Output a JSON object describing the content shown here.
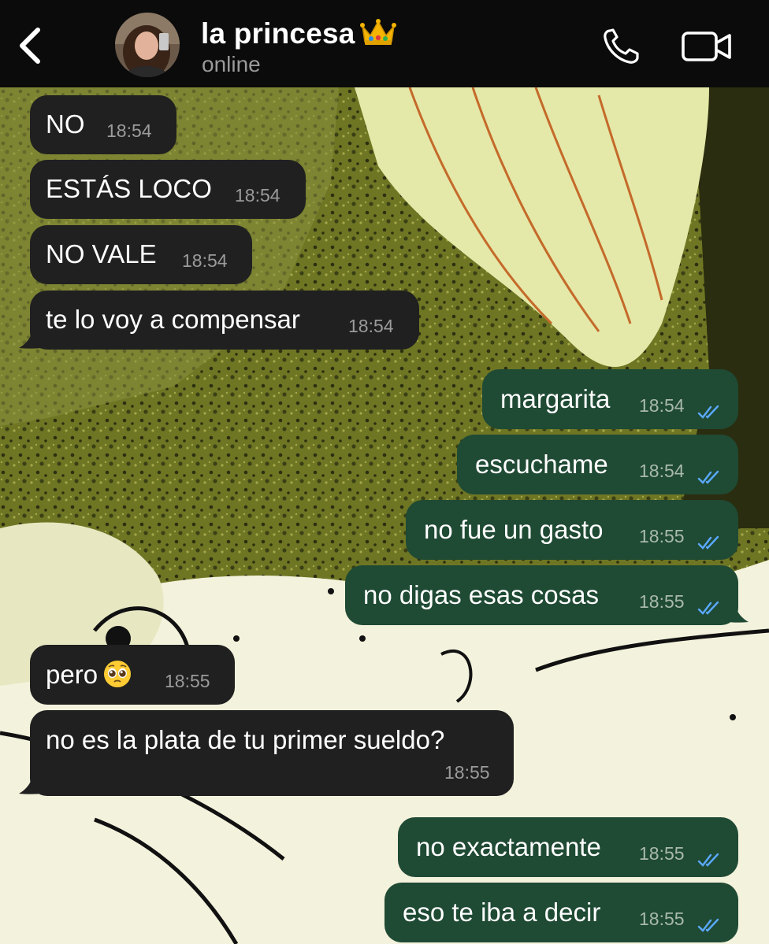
{
  "header": {
    "contact_name": "la princesa",
    "status": "online",
    "crown_emoji": "👑"
  },
  "colors": {
    "header_bg": "#0b0b0b",
    "incoming_bubble": "#202020",
    "outgoing_bubble": "#1f4a34",
    "read_ticks": "#5aa9ff"
  },
  "messages": [
    {
      "direction": "in",
      "text": "NO",
      "time": "18:54"
    },
    {
      "direction": "in",
      "text": "ESTÁS LOCO",
      "time": "18:54"
    },
    {
      "direction": "in",
      "text": "NO VALE",
      "time": "18:54"
    },
    {
      "direction": "in",
      "text": "te lo voy a compensar",
      "time": "18:54"
    },
    {
      "direction": "out",
      "text": "margarita",
      "time": "18:54"
    },
    {
      "direction": "out",
      "text": "escuchame",
      "time": "18:54"
    },
    {
      "direction": "out",
      "text": "no fue un gasto",
      "time": "18:55"
    },
    {
      "direction": "out",
      "text": "no digas esas cosas",
      "time": "18:55"
    },
    {
      "direction": "in",
      "text": "pero",
      "emoji": "🥺",
      "time": "18:55"
    },
    {
      "direction": "in",
      "text": "no es la plata de tu primer sueldo?",
      "time": "18:55"
    },
    {
      "direction": "out",
      "text": "no exactamente",
      "time": "18:55"
    },
    {
      "direction": "out",
      "text": "eso te iba a decir",
      "time": "18:55"
    }
  ],
  "icons": {
    "back": "chevron-left-icon",
    "call": "phone-icon",
    "video": "video-camera-icon",
    "read": "double-check-icon"
  }
}
